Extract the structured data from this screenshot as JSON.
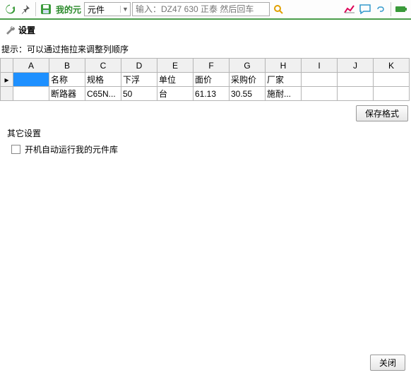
{
  "toolbar": {
    "my_components_label": "我的元",
    "combo_value": "元件",
    "search_placeholder": "输入：DZ47 630 正泰 然后回车"
  },
  "panel": {
    "title": "设置"
  },
  "hint": "提示：可以通过拖拉来调整列顺序",
  "grid": {
    "column_letters": [
      "A",
      "B",
      "C",
      "D",
      "E",
      "F",
      "G",
      "H",
      "I",
      "J",
      "K"
    ],
    "rows": [
      [
        "",
        "名称",
        "规格",
        "下浮",
        "单位",
        "面价",
        "采购价",
        "厂家",
        "",
        "",
        ""
      ],
      [
        "",
        "断路器",
        "C65N...",
        "50",
        "台",
        "61.13",
        "30.55",
        "施耐...",
        "",
        "",
        ""
      ]
    ]
  },
  "buttons": {
    "save_format": "保存格式",
    "close": "关闭"
  },
  "other": {
    "section_title": "其它设置",
    "autorun_label": "开机自动运行我的元件库"
  }
}
